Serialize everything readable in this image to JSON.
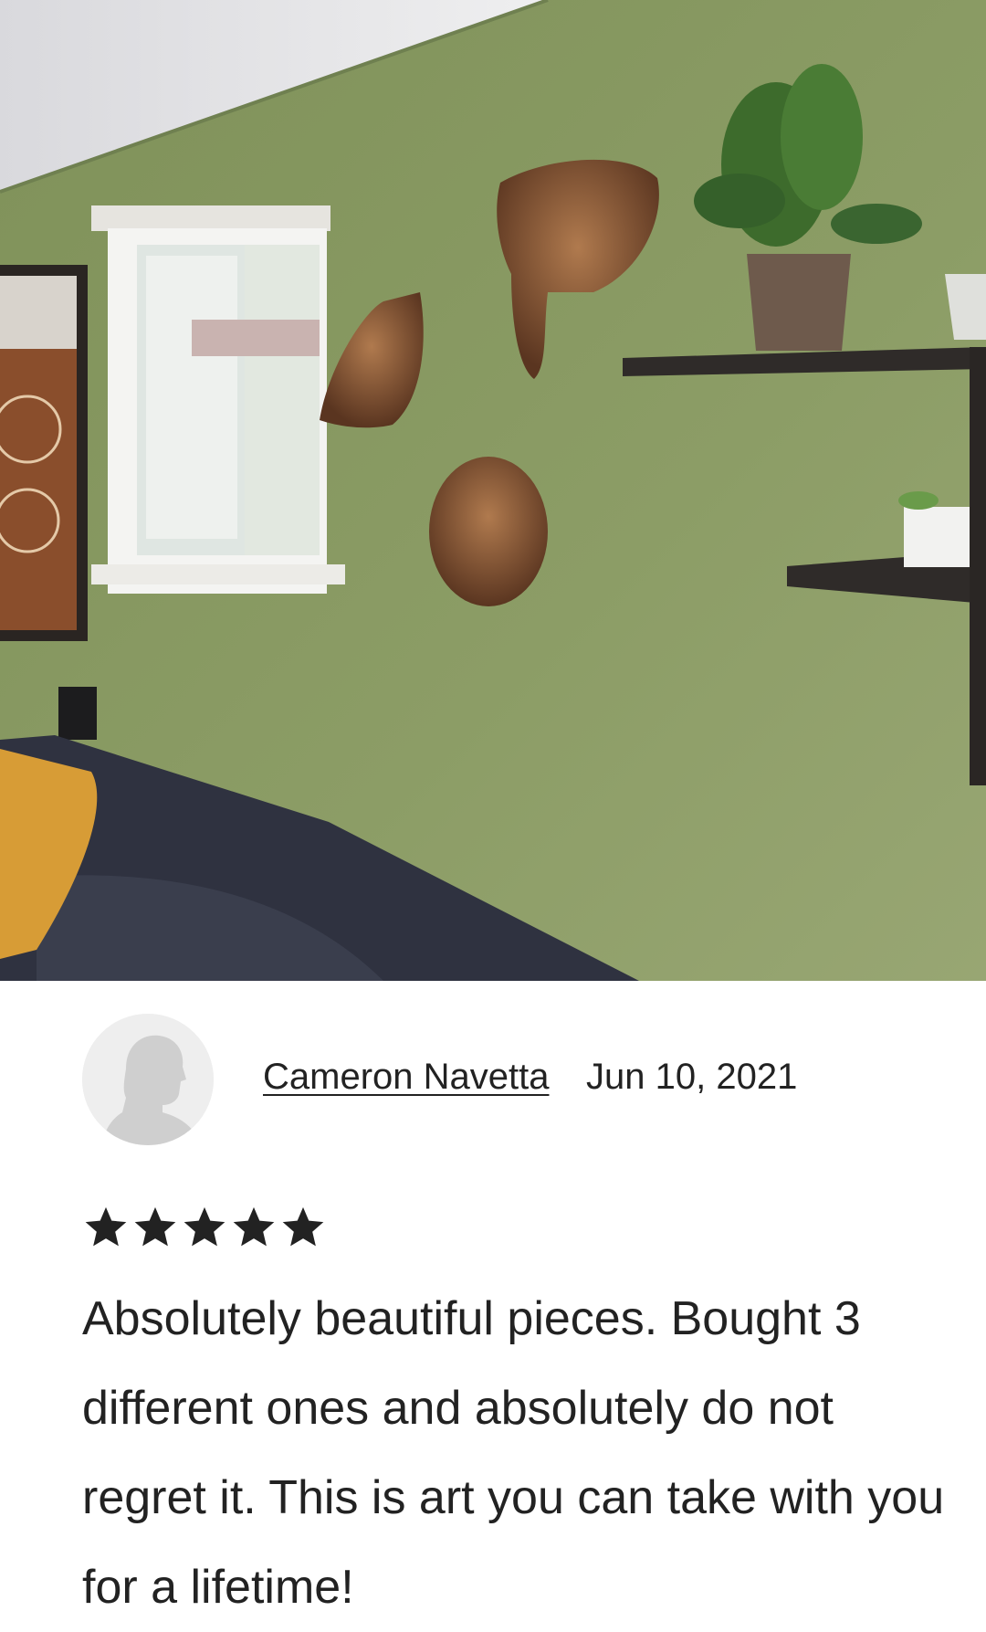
{
  "review": {
    "photo_alt": "Customer review photo",
    "reviewer_name": "Cameron Navetta",
    "date": "Jun 10, 2021",
    "rating": 5,
    "rating_max": 5,
    "text": "Absolutely beautiful pieces. Bought 3 different ones and absolutely do not regret it. This is art you can take with you for a lifetime!"
  },
  "icons": {
    "avatar": "default-user-silhouette-icon",
    "star": "star-filled-icon"
  },
  "colors": {
    "text": "#222222",
    "star": "#222222",
    "wall": "#8a9a64",
    "avatar_bg": "#eeeeee",
    "avatar_fg": "#cfcfcf"
  }
}
